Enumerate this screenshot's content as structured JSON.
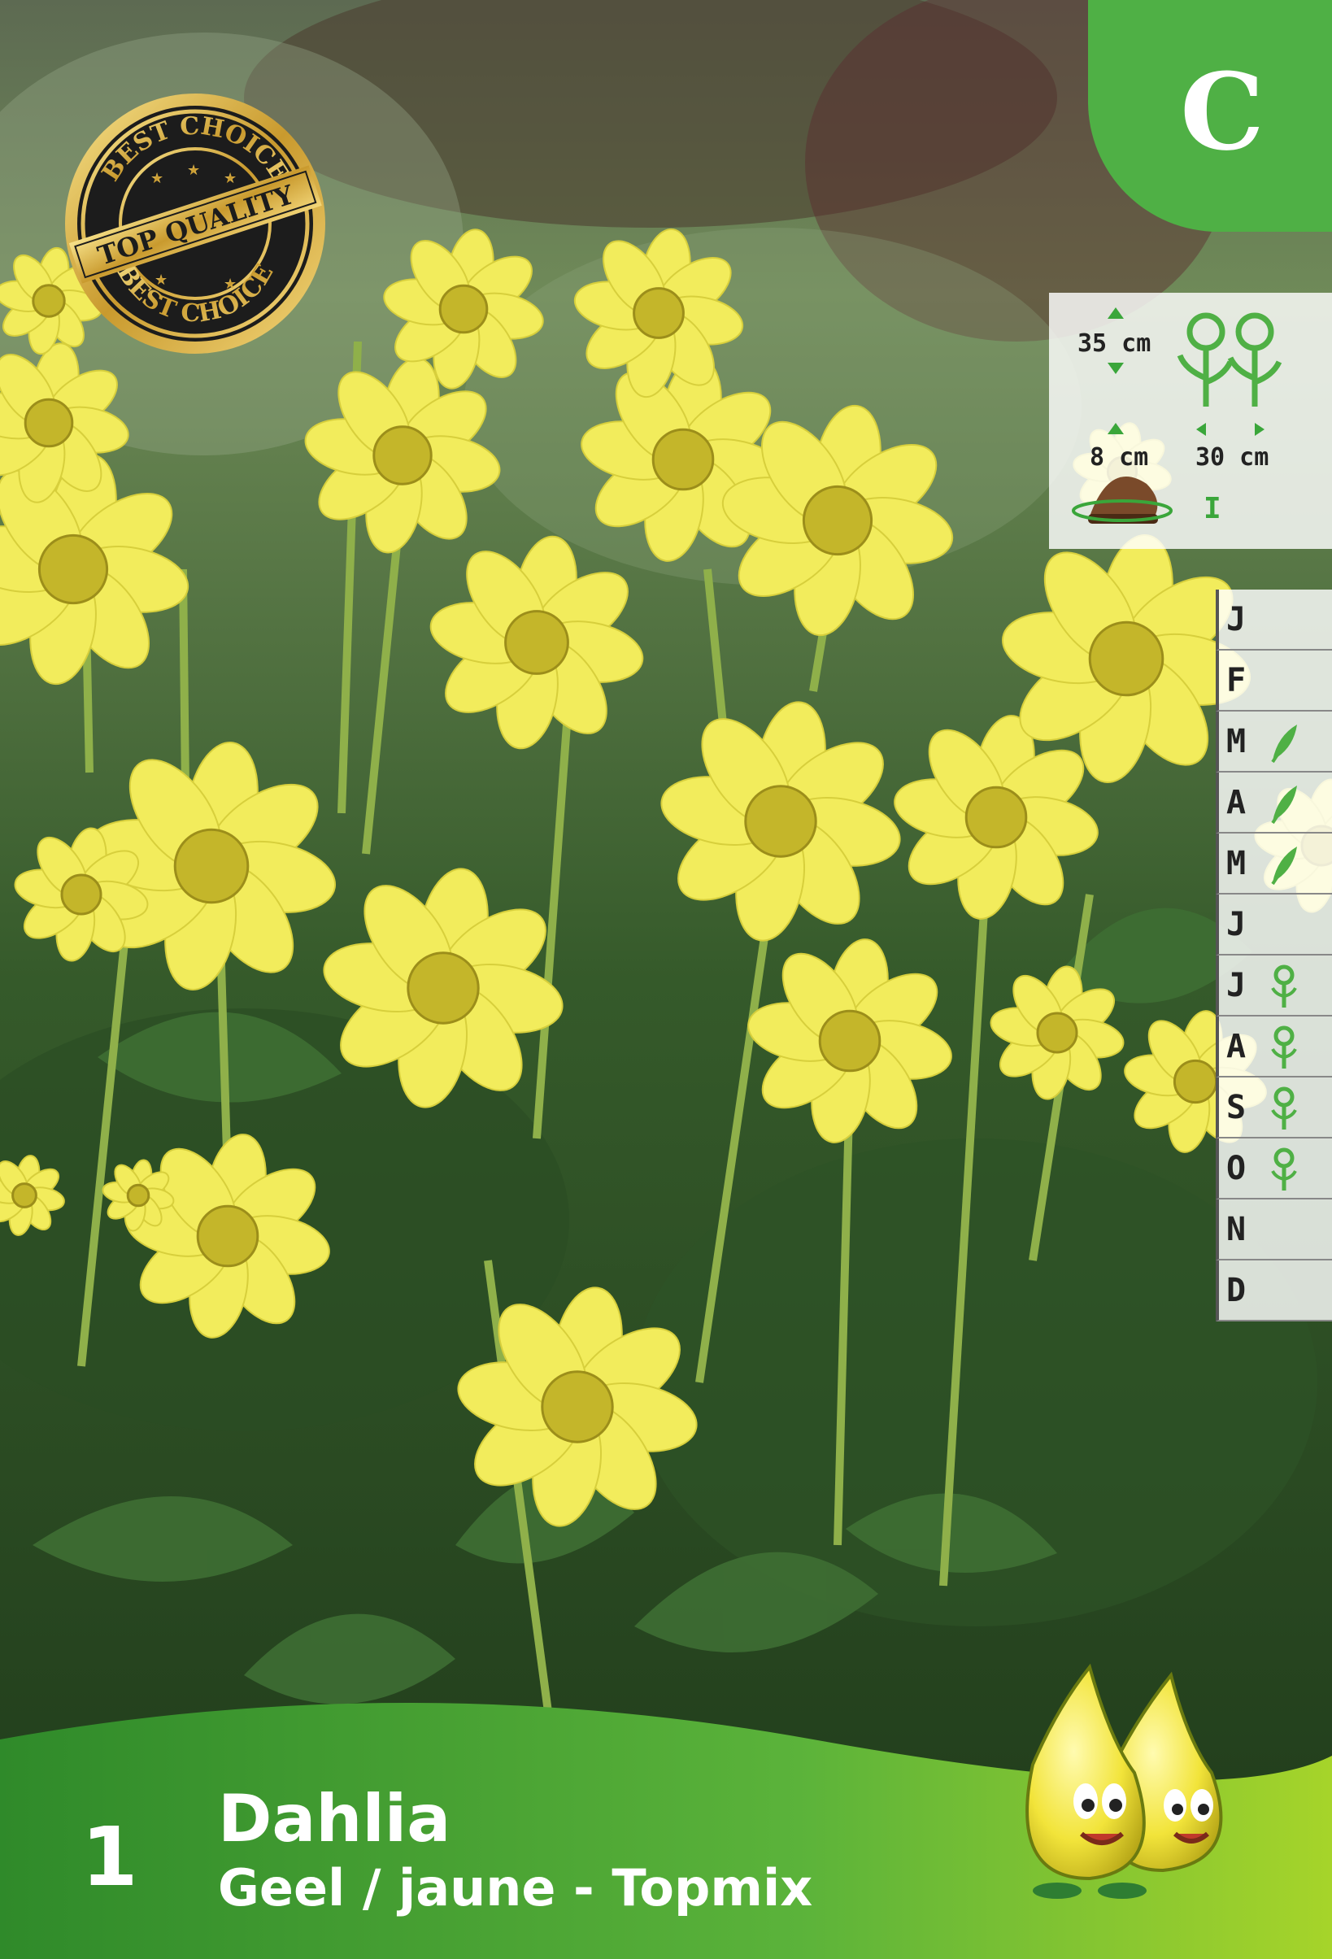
{
  "category_badge": "C",
  "seal": {
    "top_text": "BEST CHOICE",
    "center_text": "TOP QUALITY",
    "bottom_text": "BEST CHOICE"
  },
  "specs": {
    "height": "35 cm",
    "depth": "8 cm",
    "spacing": "30 cm",
    "bulb_count": "I"
  },
  "calendar": {
    "months": [
      {
        "label": "J",
        "symbol": ""
      },
      {
        "label": "F",
        "symbol": ""
      },
      {
        "label": "M",
        "symbol": "plant-icon"
      },
      {
        "label": "A",
        "symbol": "plant-icon"
      },
      {
        "label": "M",
        "symbol": "plant-icon"
      },
      {
        "label": "J",
        "symbol": ""
      },
      {
        "label": "J",
        "symbol": "flower-icon"
      },
      {
        "label": "A",
        "symbol": "flower-icon"
      },
      {
        "label": "S",
        "symbol": "flower-icon"
      },
      {
        "label": "O",
        "symbol": "flower-icon"
      },
      {
        "label": "N",
        "symbol": ""
      },
      {
        "label": "D",
        "symbol": ""
      }
    ]
  },
  "product": {
    "quantity": "1",
    "name": "Dahlia",
    "variety": "Geel / jaune - Topmix"
  },
  "colors": {
    "brand_green": "#4fb045",
    "flower_yellow": "#f2ec5c"
  }
}
